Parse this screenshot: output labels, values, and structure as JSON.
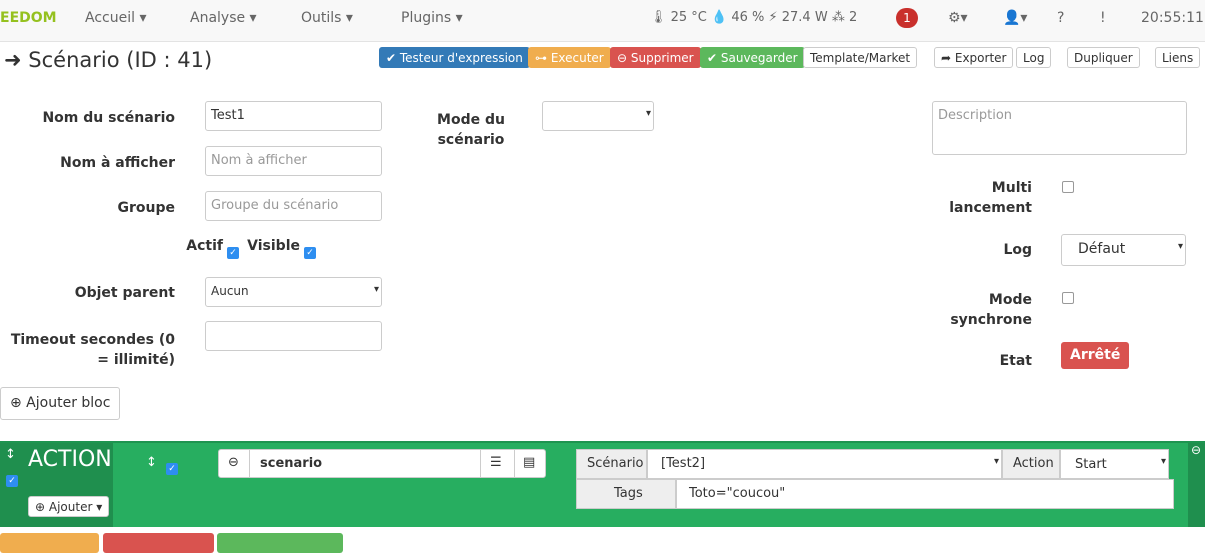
{
  "nav": {
    "logo": "EEDOM",
    "menus": [
      "Accueil ▾",
      "Analyse ▾",
      "Outils ▾",
      "Plugins ▾"
    ],
    "status": "🌡 25 °C 💧 46 % ⚡ 27.4 W ⁂ 2",
    "notifications": "1",
    "time": "20:55:11"
  },
  "page": {
    "title": "Scénario (ID : 41)"
  },
  "toolbar": [
    "✔ Testeur d'expression",
    "⊶ Executer",
    "⊖ Supprimer",
    "✔ Sauvegarder",
    "Template/Market",
    "➦ Exporter",
    "Log",
    "Dupliquer",
    "Liens"
  ],
  "form": {
    "name_label": "Nom du scénario",
    "name_value": "Test1",
    "display_label": "Nom à afficher",
    "display_ph": "Nom à afficher",
    "group_label": "Groupe",
    "group_ph": "Groupe du scénario",
    "actif": "Actif",
    "visible": "Visible",
    "parent_label": "Objet parent",
    "parent_value": "Aucun",
    "timeout_label": "Timeout secondes (0 = illimité)",
    "mode_label": "Mode du scénario",
    "description_ph": "Description",
    "multi_label": "Multi lancement",
    "log_label": "Log",
    "log_value": "Défaut",
    "sync_label": "Mode synchrone",
    "etat_label": "Etat",
    "etat_value": "Arrêté"
  },
  "add_block": "⊕ Ajouter bloc",
  "block": {
    "title": "ACTION",
    "add": "⊕ Ajouter ▾",
    "cmd": "scenario",
    "scenario_label": "Scénario",
    "scenario_value": "[Test2]",
    "action_label": "Action",
    "action_value": "Start",
    "tags_label": "Tags",
    "tags_value": "Toto=\"coucou\""
  },
  "colors": {
    "primary": "#337ab7",
    "warning": "#f0ad4e",
    "danger": "#d9534f",
    "success": "#5cb85c",
    "block": "#27ae60"
  }
}
